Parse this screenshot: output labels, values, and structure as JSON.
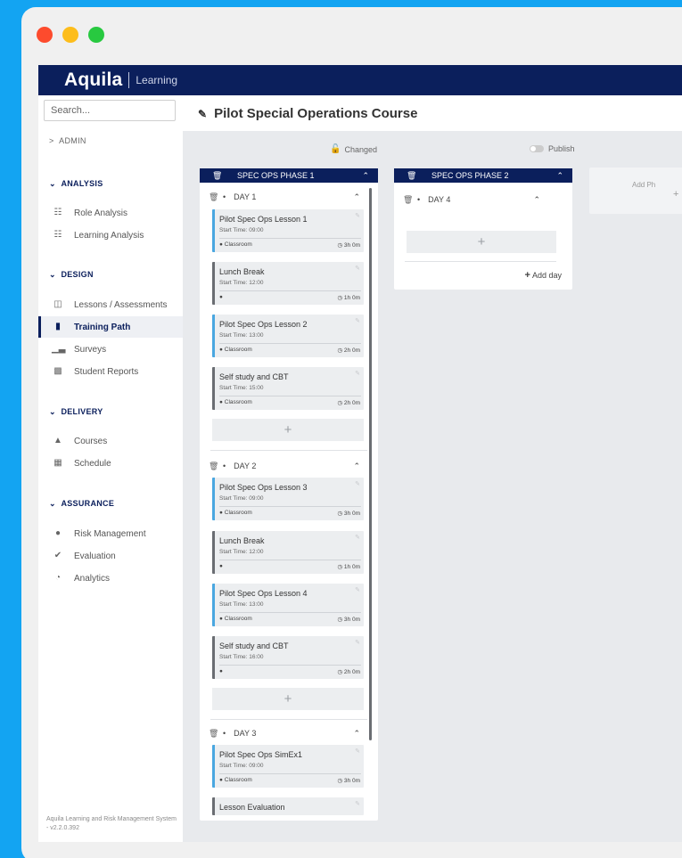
{
  "app": {
    "logo_main": "Aquila",
    "logo_sub": "Learning"
  },
  "sidebar": {
    "search_placeholder": "Search...",
    "admin": "ADMIN",
    "sections": {
      "analysis": "ANALYSIS",
      "design": "DESIGN",
      "delivery": "DELIVERY",
      "assurance": "ASSURANCE"
    },
    "items": {
      "role_analysis": "Role Analysis",
      "learning_analysis": "Learning Analysis",
      "lessons_assessments": "Lessons / Assessments",
      "training_path": "Training Path",
      "surveys": "Surveys",
      "student_reports": "Student Reports",
      "courses": "Courses",
      "schedule": "Schedule",
      "risk_management": "Risk Management",
      "evaluation": "Evaluation",
      "analytics": "Analytics"
    },
    "version": "Aquila Learning and Risk Management System - v2.2.0.392"
  },
  "header": {
    "title": "Pilot Special Operations Course"
  },
  "board": {
    "changed": "Changed",
    "publish": "Publish",
    "add_phase": "Add Ph",
    "add_day": "Add day",
    "phase1": {
      "name": "SPEC OPS PHASE 1",
      "day1": {
        "name": "DAY 1",
        "l1": {
          "title": "Pilot Spec Ops Lesson 1",
          "start": "Start Time: 09:00",
          "loc": "Classroom",
          "dur": "3h 0m"
        },
        "l2": {
          "title": "Lunch Break",
          "start": "Start Time: 12:00",
          "loc": "",
          "dur": "1h 0m"
        },
        "l3": {
          "title": "Pilot Spec Ops Lesson 2",
          "start": "Start Time: 13:00",
          "loc": "Classroom",
          "dur": "2h 0m"
        },
        "l4": {
          "title": "Self study and CBT",
          "start": "Start Time: 15:00",
          "loc": "Classroom",
          "dur": "2h 0m"
        }
      },
      "day2": {
        "name": "DAY 2",
        "l1": {
          "title": "Pilot Spec Ops Lesson 3",
          "start": "Start Time: 09:00",
          "loc": "Classroom",
          "dur": "3h 0m"
        },
        "l2": {
          "title": "Lunch Break",
          "start": "Start Time: 12:00",
          "loc": "",
          "dur": "1h 0m"
        },
        "l3": {
          "title": "Pilot Spec Ops Lesson 4",
          "start": "Start Time: 13:00",
          "loc": "Classroom",
          "dur": "3h 0m"
        },
        "l4": {
          "title": "Self study and CBT",
          "start": "Start Time: 16:00",
          "loc": "",
          "dur": "2h 0m"
        }
      },
      "day3": {
        "name": "DAY 3",
        "l1": {
          "title": "Pilot Spec Ops SimEx1",
          "start": "Start Time: 09:00",
          "loc": "Classroom",
          "dur": "3h 0m"
        },
        "l2": {
          "title": "Lesson Evaluation"
        }
      }
    },
    "phase2": {
      "name": "SPEC OPS PHASE 2",
      "day4": {
        "name": "DAY 4"
      }
    }
  },
  "colors": {
    "navy": "#0b1f5c",
    "accent_blue": "#4aa7e0",
    "grey_bar": "#6a6d72",
    "background": "#13a4f2"
  }
}
